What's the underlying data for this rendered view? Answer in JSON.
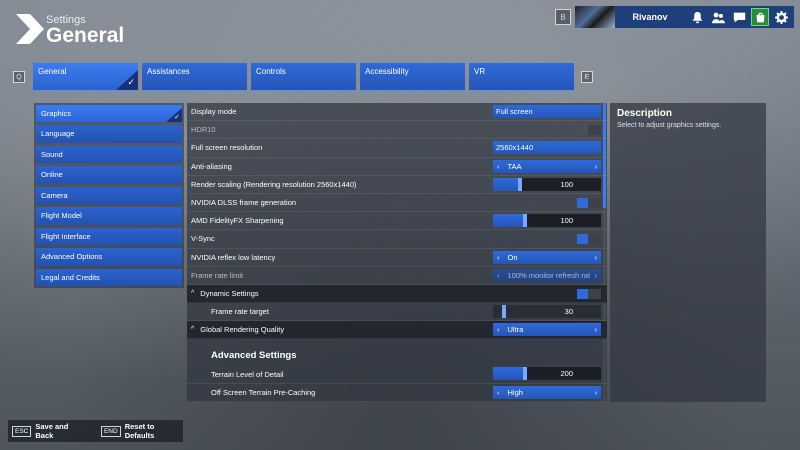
{
  "header": {
    "subtitle": "Settings",
    "title": "General"
  },
  "profile": {
    "key": "B",
    "username": "Rivanov",
    "icons": [
      "bell-icon",
      "friends-icon",
      "chat-icon",
      "marketplace-icon",
      "gear-icon"
    ]
  },
  "tabs": {
    "prev_key": "Q",
    "next_key": "E",
    "items": [
      {
        "label": "General",
        "active": true
      },
      {
        "label": "Assistances",
        "active": false
      },
      {
        "label": "Controls",
        "active": false
      },
      {
        "label": "Accessibility",
        "active": false
      },
      {
        "label": "VR",
        "active": false
      }
    ]
  },
  "categories": [
    {
      "label": "Graphics",
      "active": true
    },
    {
      "label": "Language"
    },
    {
      "label": "Sound"
    },
    {
      "label": "Online"
    },
    {
      "label": "Camera"
    },
    {
      "label": "Flight Model"
    },
    {
      "label": "Flight Interface"
    },
    {
      "label": "Advanced Options"
    },
    {
      "label": "Legal and Credits"
    }
  ],
  "settings": {
    "display_mode": {
      "label": "Display mode",
      "value": "Full screen"
    },
    "hdr10": {
      "label": "HDR10",
      "on": false
    },
    "resolution": {
      "label": "Full screen resolution",
      "value": "2560x1440"
    },
    "anti_aliasing": {
      "label": "Anti-aliasing",
      "value": "TAA"
    },
    "render_scaling": {
      "label": "Render scaling (Rendering resolution 2560x1440)",
      "value": "100",
      "level": 0.25
    },
    "dlss_fg": {
      "label": "NVIDIA DLSS frame generation",
      "on": true
    },
    "fidelityfx": {
      "label": "AMD FidelityFX Sharpening",
      "value": "100",
      "level": 0.3
    },
    "vsync": {
      "label": "V-Sync",
      "on": true
    },
    "reflex": {
      "label": "NVIDIA reflex low latency",
      "value": "On"
    },
    "frame_rate_limit": {
      "label": "Frame rate limit",
      "value": "100% monitor refresh rat"
    },
    "dynamic_settings": {
      "label": "Dynamic Settings",
      "on": true
    },
    "frame_rate_target": {
      "label": "Frame rate target",
      "value": "30",
      "level": 0.1
    },
    "global_quality": {
      "label": "Global Rendering Quality",
      "value": "Ultra"
    },
    "advanced_heading": "Advanced Settings",
    "terrain_lod": {
      "label": "Terrain Level of Detail",
      "value": "200",
      "level": 0.3
    },
    "terrain_precache": {
      "label": "Off Screen Terrain Pre-Caching",
      "value": "High"
    }
  },
  "description": {
    "title": "Description",
    "text": "Select to adjust graphics settings."
  },
  "footer": {
    "esc_key": "ESC",
    "esc_label": "Save and Back",
    "end_key": "END",
    "end_label": "Reset to Defaults"
  },
  "colors": {
    "accent": "#2f6ad8",
    "panel": "#30363f",
    "profile_bar": "#1f3f7a"
  }
}
